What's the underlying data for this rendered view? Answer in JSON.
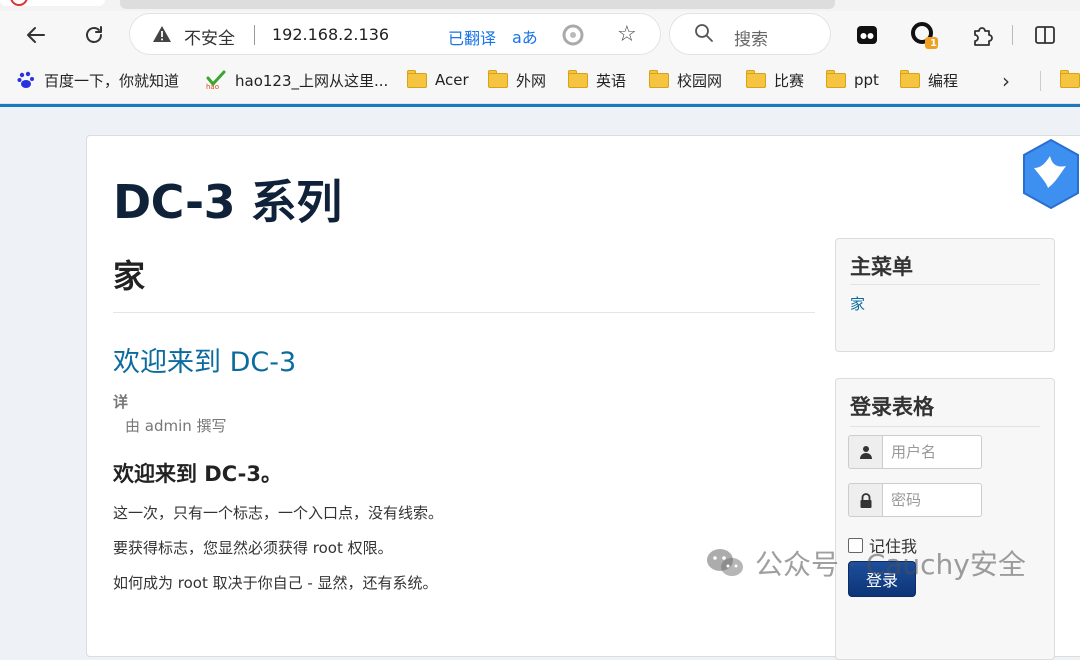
{
  "browser": {
    "address": {
      "security_label": "不安全",
      "url": "192.168.2.136",
      "translated_label": "已翻译",
      "translate_glyph": "aあ"
    },
    "search_placeholder": "搜索",
    "extension_badge_count": "1",
    "bookmarks": [
      {
        "label": "百度一下，你就知道",
        "icon": "baidu-icon"
      },
      {
        "label": "hao123_上网从这里...",
        "icon": "hao123-icon"
      },
      {
        "label": "Acer",
        "icon": "folder-icon"
      },
      {
        "label": "外网",
        "icon": "folder-icon"
      },
      {
        "label": "英语",
        "icon": "folder-icon"
      },
      {
        "label": "校园网",
        "icon": "folder-icon"
      },
      {
        "label": "比赛",
        "icon": "folder-icon"
      },
      {
        "label": "ppt",
        "icon": "folder-icon"
      },
      {
        "label": "编程",
        "icon": "folder-icon"
      }
    ]
  },
  "site": {
    "title": "DC-3 系列",
    "section_heading": "家",
    "article": {
      "title": "欢迎来到 DC-3",
      "detail_label": "详",
      "author": "由 admin 撰写",
      "heading": "欢迎来到 DC-3。",
      "paragraphs": [
        "这一次，只有一个标志，一个入口点，没有线索。",
        "要获得标志，您显然必须获得 root 权限。",
        "如何成为 root 取决于你自己 - 显然，还有系统。"
      ]
    },
    "main_menu": {
      "title": "主菜单",
      "items": [
        "家"
      ]
    },
    "login_form": {
      "title": "登录表格",
      "username_placeholder": "用户名",
      "password_placeholder": "密码",
      "remember_label": "记住我",
      "login_label": "登录"
    }
  },
  "watermark": {
    "text": "公众号 · Cauchy安全"
  },
  "colors": {
    "accent": "#1c79c0",
    "link": "#0b6b9e",
    "title": "#10223a",
    "login_button": "#0d3477"
  }
}
